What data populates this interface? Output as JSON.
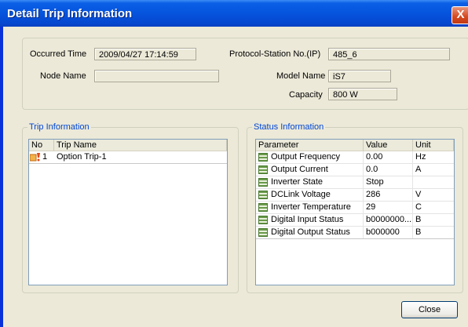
{
  "window": {
    "title": "Detail Trip Information",
    "close_glyph": "X"
  },
  "top": {
    "occurred_time_label": "Occurred Time",
    "occurred_time_value": "2009/04/27 17:14:59",
    "protocol_label": "Protocol-Station No.(IP)",
    "protocol_value": "485_6",
    "node_name_label": "Node Name",
    "node_name_value": "",
    "model_name_label": "Model Name",
    "model_name_value": "iS7",
    "capacity_label": "Capacity",
    "capacity_value": "800 W"
  },
  "trip": {
    "group_title": "Trip Information",
    "columns": [
      "No",
      "Trip Name"
    ],
    "rows": [
      {
        "no": "1",
        "name": "Option Trip-1",
        "icon": "trip-warning-icon"
      }
    ]
  },
  "status": {
    "group_title": "Status Information",
    "columns": [
      "Parameter",
      "Value",
      "Unit"
    ],
    "rows": [
      {
        "parameter": "Output Frequency",
        "value": "0.00",
        "unit": "Hz"
      },
      {
        "parameter": "Output Current",
        "value": "0.0",
        "unit": "A"
      },
      {
        "parameter": "Inverter State",
        "value": "Stop",
        "unit": ""
      },
      {
        "parameter": "DCLink Voltage",
        "value": "286",
        "unit": "V"
      },
      {
        "parameter": "Inverter Temperature",
        "value": "29",
        "unit": "C"
      },
      {
        "parameter": "Digital Input Status",
        "value": "b0000000...",
        "unit": "B"
      },
      {
        "parameter": "Digital Output Status",
        "value": "b000000",
        "unit": "B"
      }
    ]
  },
  "buttons": {
    "close": "Close"
  }
}
